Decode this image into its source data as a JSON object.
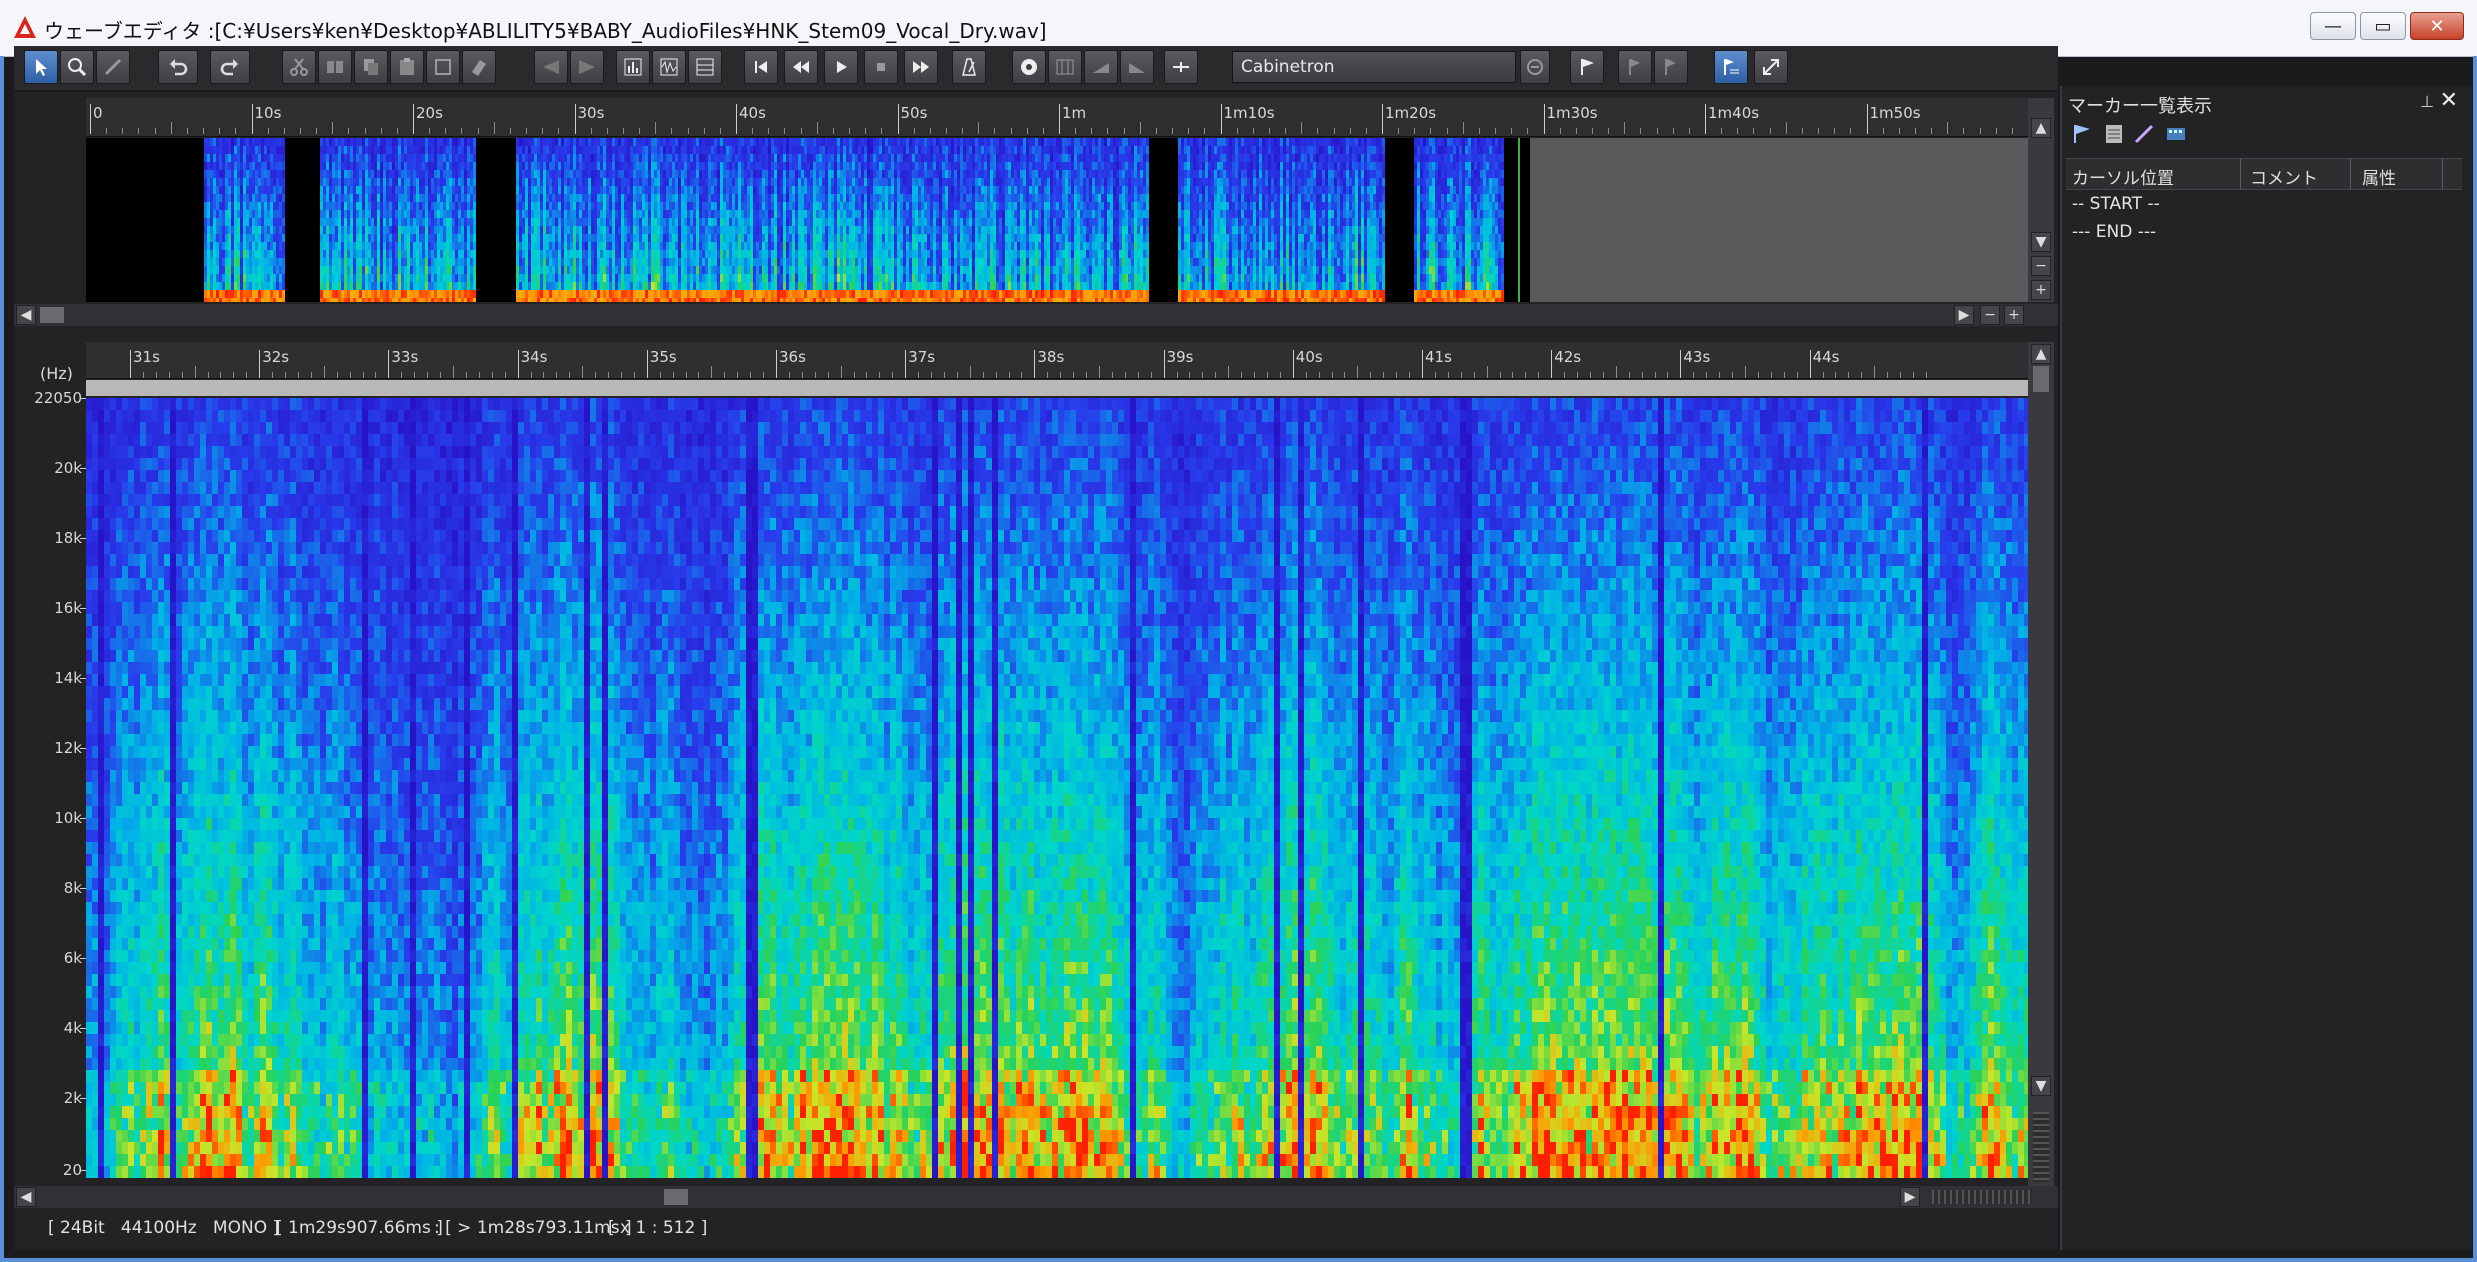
{
  "window": {
    "title": "ウェーブエディタ :[C:¥Users¥ken¥Desktop¥ABLILITY5¥BABY_AudioFiles¥HNK_Stem09_Vocal_Dry.wav]",
    "controls": {
      "minimize": "—",
      "maximize": "▭",
      "close": "✕"
    }
  },
  "toolbar": {
    "effect_name": "Cabinetron",
    "buttons": [
      "pointer-tool",
      "zoom-tool",
      "pencil-tool",
      "undo",
      "redo",
      "cut",
      "scissors",
      "copy",
      "paste",
      "crop",
      "erase",
      "trim-left",
      "trim-right",
      "spectrum-view",
      "waveform-view",
      "grid-view",
      "skip-to-start",
      "rewind",
      "play",
      "stop",
      "fast-forward",
      "metronome",
      "record",
      "mixer",
      "fade-in",
      "fade-out",
      "insert-silence",
      "effect-power",
      "marker-flag",
      "prev-marker",
      "next-marker",
      "marker-list",
      "fullscreen"
    ]
  },
  "overview": {
    "ruler_labels": [
      "0",
      "10s",
      "20s",
      "30s",
      "40s",
      "50s",
      "1m",
      "1m10s",
      "1m20s",
      "1m30s",
      "1m40s",
      "1m50s"
    ]
  },
  "detail": {
    "unit_label": "(Hz)",
    "ruler_labels": [
      "31s",
      "32s",
      "33s",
      "34s",
      "35s",
      "36s",
      "37s",
      "38s",
      "39s",
      "40s",
      "41s",
      "42s",
      "43s",
      "44s"
    ],
    "freq_labels": [
      "22050",
      "20k",
      "18k",
      "16k",
      "14k",
      "12k",
      "10k",
      "8k",
      "6k",
      "4k",
      "2k",
      "20"
    ]
  },
  "status": {
    "format": "[ 24Bit   44100Hz   MONO ]",
    "length": "[ 1m29s907.66ms ]",
    "cursor": ": [ > 1m28s793.11ms ]",
    "zoom": "[ x 1 : 512 ]"
  },
  "marker_panel": {
    "title": "マーカー一覧表示",
    "pin": "⊥",
    "close": "✕",
    "columns": [
      "カーソル位置",
      "コメント",
      "属性"
    ],
    "rows": [
      "-- START --",
      "--- END ---"
    ],
    "icons": [
      "flag-icon",
      "list-icon",
      "edit-icon",
      "filmstrip-icon"
    ]
  },
  "colors": {
    "background": "#1b1b1d",
    "spectrogram_low": "#1a22c8",
    "spectrogram_high": "#ff2a00",
    "accent": "#3fae4a"
  }
}
